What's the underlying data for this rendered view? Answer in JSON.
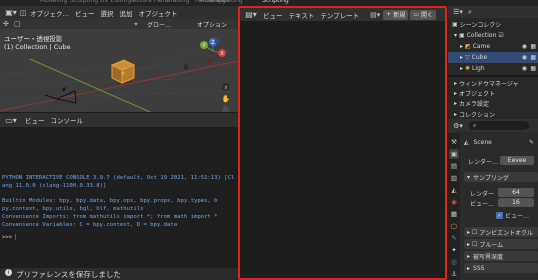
{
  "top_tabs": [
    {
      "label": "Modeling",
      "active": false
    },
    {
      "label": "Sculpting",
      "active": false
    },
    {
      "label": "UV Editing",
      "active": false
    },
    {
      "label": "Texture Paint",
      "active": false
    },
    {
      "label": "Shading",
      "active": false
    },
    {
      "label": "Animation",
      "active": false
    },
    {
      "label": "Rendering",
      "active": false
    },
    {
      "label": "Compositing",
      "active": false
    },
    {
      "label": "Scripting",
      "active": true
    }
  ],
  "viewport": {
    "mode": "オブジェク…",
    "menus": [
      "ビュー",
      "選択",
      "追加",
      "オブジェクト"
    ],
    "orientation": "グロー…",
    "overlay": "オプション",
    "view_name": "ユーザー・透視投影",
    "collection_info": "(1) Collection | Cube",
    "gizmo_axes": {
      "x": "X",
      "y": "Y",
      "z": "Z"
    }
  },
  "console": {
    "menus": [
      "ビュー",
      "コンソール"
    ],
    "lines": [
      "PYTHON INTERACTIVE CONSOLE 3.9.7 (default, Oct 19 2021, 11:51:13)  [Cl",
      "ang 11.0.0 (clang-1100.0.33.8)]",
      "",
      "Builtin Modules:       bpy, bpy.data, bpy.ops, bpy.props, bpy.types, b",
      "py.context, bpy.utils, bgl, blf, mathutils",
      "Convenience Imports:   from mathutils import *; from math import *",
      "Convenience Variables: C = bpy.context, D = bpy.data"
    ],
    "prompt": ">>> ",
    "status": "プリファレンスを保存しました"
  },
  "text_editor": {
    "menus": [
      "ビュー",
      "テキスト",
      "テンプレート"
    ],
    "new_label": "新規",
    "open_label": "開く"
  },
  "outliner": {
    "items": [
      {
        "label": "シーンコレクシ",
        "selected": false
      },
      {
        "label": "Collection",
        "selected": false
      },
      {
        "label": "Came",
        "selected": false
      },
      {
        "label": "Cube",
        "selected": true
      },
      {
        "label": "Ligh",
        "selected": false
      }
    ]
  },
  "properties": {
    "data_items": [
      "ウィンドウマネージャ",
      "オブジェクト",
      "カメラ設定",
      "コレクション"
    ],
    "scene_label": "Scene",
    "engine_label": "レンダー…",
    "engine_value": "Eevee",
    "sampling_title": "サンプリング",
    "render_label": "レンダー",
    "render_value": "64",
    "viewport_label": "ビュー…",
    "viewport_value": "16",
    "denoise_label": "ビュー…",
    "panels": [
      "アンビエントオクル",
      "ブルーム",
      "被写界深度",
      "SSS"
    ]
  }
}
